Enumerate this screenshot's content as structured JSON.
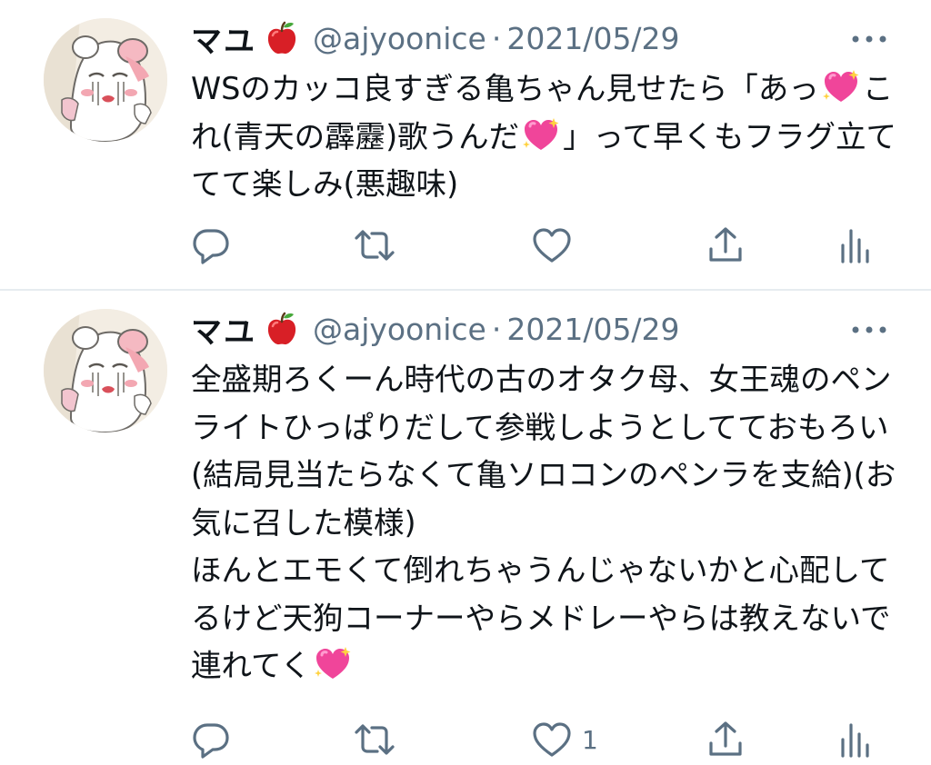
{
  "colors": {
    "text": "#0f1419",
    "secondary": "#5b7083",
    "divider": "#e6ecf0",
    "heart_emoji": "#f0459a",
    "apple_emoji": "#d81f26"
  },
  "icons": {
    "header_emoji": "red-apple-icon",
    "inline_emoji": "sparkling-heart-icon",
    "actions": [
      "reply-icon",
      "retweet-icon",
      "like-icon",
      "share-icon",
      "analytics-icon"
    ]
  },
  "tweets": [
    {
      "name": "マユ",
      "handle": "@ajyoonice",
      "dot": "·",
      "date": "2021/05/29",
      "text_parts": [
        "WSのカッコ良すぎる亀ちゃん見せたら「あっ",
        "これ(青天の霹靂)歌うんだ",
        "」って早くもフラグ立ててて楽しみ(悪趣味)"
      ],
      "like_count": ""
    },
    {
      "name": "マユ",
      "handle": "@ajyoonice",
      "dot": "·",
      "date": "2021/05/29",
      "text_parts": [
        "全盛期ろくーん時代の古のオタク母、女王魂のペンライトひっぱりだして参戦しようとしてておもろい(結局見当たらなくて亀ソロコンのペンラを支給)(お気に召した模様)\nほんとエモくて倒れちゃうんじゃないかと心配してるけど天狗コーナーやらメドレーやらは教えないで連れてく"
      ],
      "like_count": "1"
    }
  ]
}
